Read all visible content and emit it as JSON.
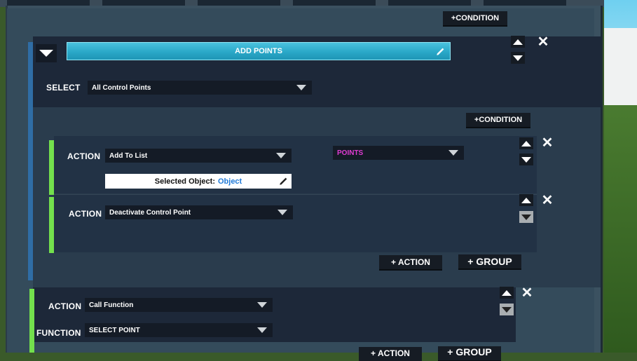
{
  "colors": {
    "accent": "#2aa8c8",
    "action_bar": "#73e04d",
    "points_label": "#e03cd2",
    "object_link": "#1f7ad8"
  },
  "toolbar": {
    "condition_top": "+CONDITION"
  },
  "block": {
    "title": "ADD POINTS",
    "select_label": "SELECT",
    "select_value": "All Control Points",
    "condition_button": "+CONDITION",
    "actions": [
      {
        "label": "ACTION",
        "value": "Add To List",
        "param_label": "POINTS",
        "field_prefix": "Selected Object:",
        "field_value": "Object"
      },
      {
        "label": "ACTION",
        "value": "Deactivate Control Point"
      }
    ],
    "add_action": "+ ACTION",
    "add_group": "+ GROUP"
  },
  "call_action": {
    "label": "ACTION",
    "value": "Call Function",
    "function_label": "FUNCTION",
    "function_value": "SELECT POINT"
  },
  "bottom": {
    "add_action": "+ ACTION",
    "add_group": "+ GROUP"
  },
  "icons": {
    "close": "✕",
    "up": "arrow-up-icon",
    "down": "arrow-down-icon",
    "pencil": "pencil-icon",
    "collapse": "chevron-down-icon"
  }
}
